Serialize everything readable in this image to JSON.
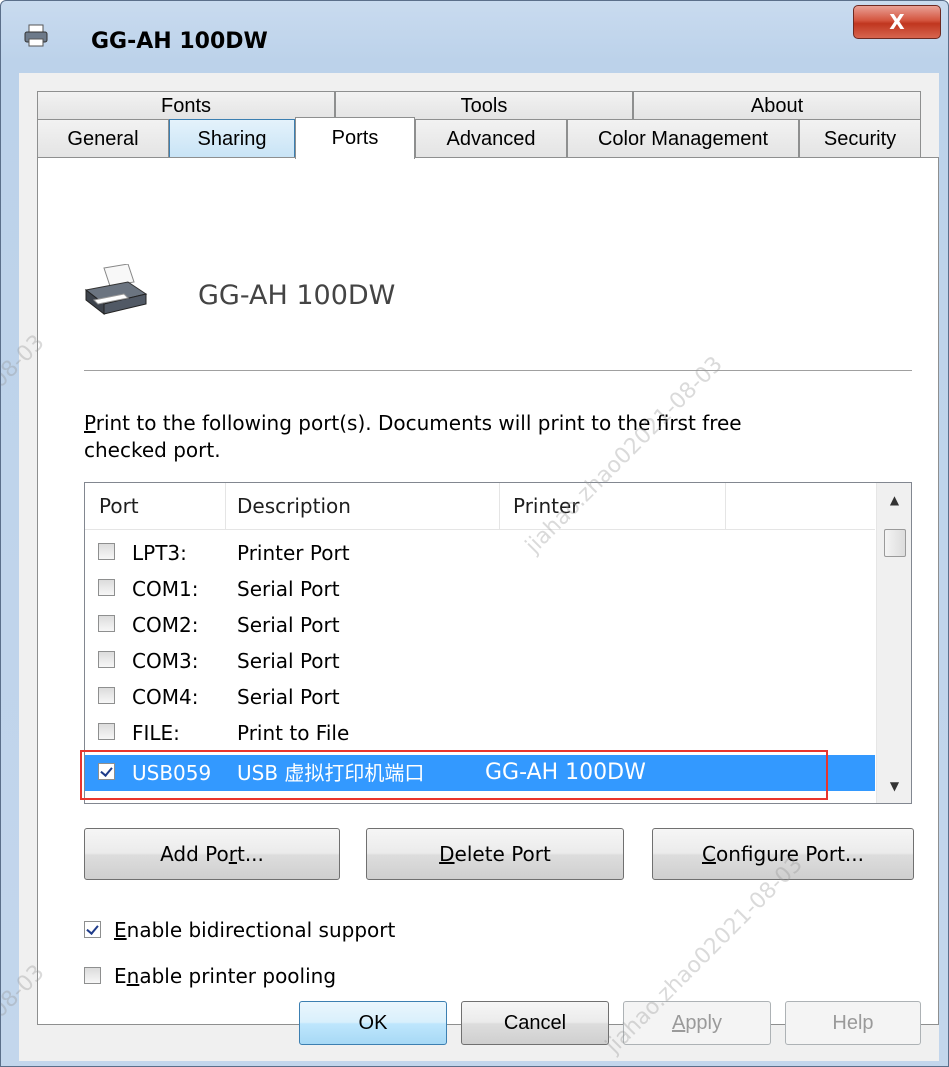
{
  "window": {
    "title": "GG-AH 100DW",
    "close_glyph": "X"
  },
  "tabs": {
    "row1": [
      "Fonts",
      "Tools",
      "About"
    ],
    "row2": [
      "General",
      "Sharing",
      "Ports",
      "Advanced",
      "Color Management",
      "Security"
    ],
    "active": "Ports"
  },
  "page": {
    "printer_name": "GG-AH 100DW",
    "instruction_pre": "",
    "instruction_key": "P",
    "instruction_rest": "rint to the following port(s). Documents will print to the first free checked port.",
    "ports_list": {
      "columns": [
        "Port",
        "Description",
        "Printer"
      ],
      "rows": [
        {
          "port": "LPT3:",
          "description": "Printer Port",
          "printer": "",
          "checked": false,
          "selected": false
        },
        {
          "port": "COM1:",
          "description": "Serial Port",
          "printer": "",
          "checked": false,
          "selected": false
        },
        {
          "port": "COM2:",
          "description": "Serial Port",
          "printer": "",
          "checked": false,
          "selected": false
        },
        {
          "port": "COM3:",
          "description": "Serial Port",
          "printer": "",
          "checked": false,
          "selected": false
        },
        {
          "port": "COM4:",
          "description": "Serial Port",
          "printer": "",
          "checked": false,
          "selected": false
        },
        {
          "port": "FILE:",
          "description": "Print to File",
          "printer": "",
          "checked": false,
          "selected": false
        },
        {
          "port": "USB059",
          "description": "USB 虚拟打印机端口",
          "printer": "GG-AH 100DW",
          "checked": true,
          "selected": true
        }
      ]
    },
    "buttons": {
      "add_port_pre": "Add Po",
      "add_port_key": "r",
      "add_port_post": "t...",
      "delete_port_key": "D",
      "delete_port_post": "elete Port",
      "configure_port_key": "C",
      "configure_port_post": "onfigure Port..."
    },
    "options": {
      "bidirectional_key": "E",
      "bidirectional_rest": "nable bidirectional support",
      "bidirectional_checked": true,
      "pooling_pre": "E",
      "pooling_key": "n",
      "pooling_rest": "able printer pooling",
      "pooling_checked": false
    }
  },
  "dialog_buttons": {
    "ok": "OK",
    "cancel": "Cancel",
    "apply_key": "A",
    "apply_rest": "pply",
    "help": "Help"
  },
  "watermark": {
    "text_a": "jiahao.zhao02021-08-03",
    "text_b": "-08-03"
  },
  "colors": {
    "selection": "#3399ff",
    "highlight_box": "#e8352e",
    "close_button": "#c9452f"
  }
}
